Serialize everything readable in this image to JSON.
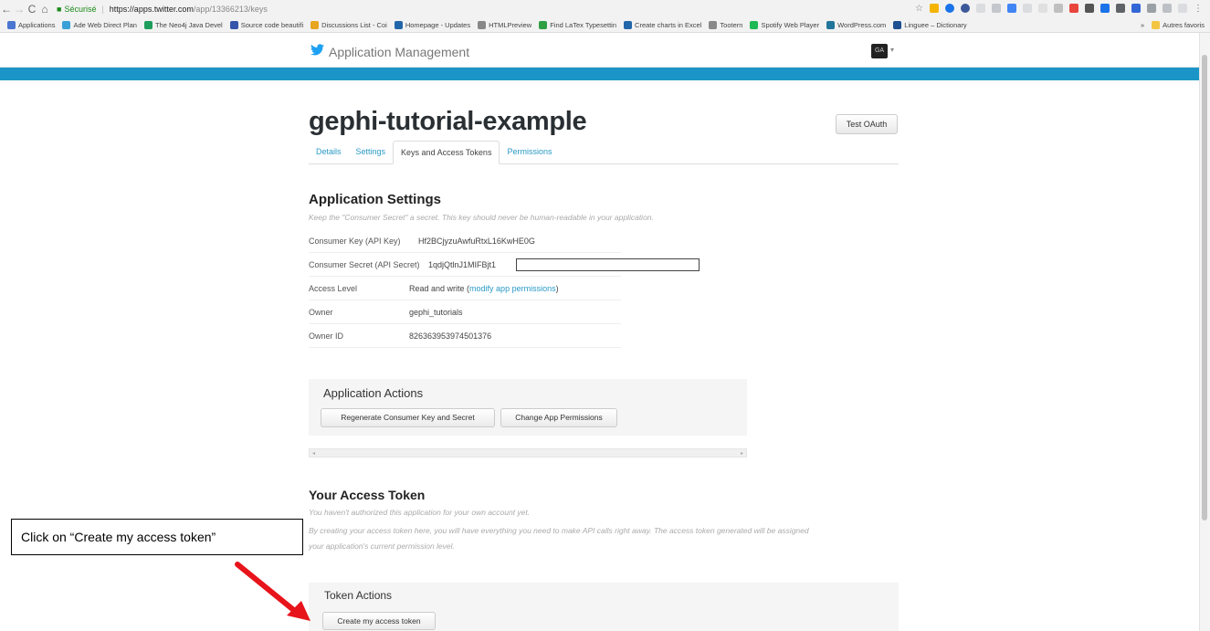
{
  "browser": {
    "secure_label": "Sécurisé",
    "url_host": "https://apps.twitter.com",
    "url_path": "/app/13366213/keys",
    "bookmarks": [
      {
        "label": "Applications",
        "color": "#4a76d1"
      },
      {
        "label": "Ade Web Direct Plan",
        "color": "#3aa0d8"
      },
      {
        "label": "The Neo4j Java Devel",
        "color": "#1e9e5a"
      },
      {
        "label": "Source code beautifi",
        "color": "#3355aa"
      },
      {
        "label": "Discussions List - Coi",
        "color": "#e8a520"
      },
      {
        "label": "Homepage - Updates",
        "color": "#2266aa"
      },
      {
        "label": "HTMLPreview",
        "color": "#888888"
      },
      {
        "label": "Find LaTex Typesettin",
        "color": "#2ea043"
      },
      {
        "label": "Create charts in Excel",
        "color": "#2266aa"
      },
      {
        "label": "Tootern",
        "color": "#888888"
      },
      {
        "label": "Spotify Web Player",
        "color": "#1db954"
      },
      {
        "label": "WordPress.com",
        "color": "#21759b"
      },
      {
        "label": "Linguee – Dictionary",
        "color": "#1d4f91"
      }
    ],
    "bookmarks_more": "»",
    "other_bookmarks": "Autres favoris"
  },
  "header": {
    "brand": "Application Management",
    "avatar_initials": "GA"
  },
  "app": {
    "title": "gephi-tutorial-example",
    "test_oauth": "Test OAuth",
    "tabs": [
      {
        "label": "Details"
      },
      {
        "label": "Settings"
      },
      {
        "label": "Keys and Access Tokens"
      },
      {
        "label": "Permissions"
      }
    ]
  },
  "settings": {
    "heading": "Application Settings",
    "note": "Keep the \"Consumer Secret\" a secret. This key should never be human-readable in your application.",
    "rows": [
      {
        "label": "Consumer Key (API Key)",
        "value": "Hf2BCjyzuAwfuRtxL16KwHE0G"
      },
      {
        "label": "Consumer Secret (API Secret)",
        "value": "1qdjQtlnJ1MIFBjt1"
      },
      {
        "label": "Access Level",
        "value": "Read and write (",
        "link": "modify app permissions",
        "after": ")"
      },
      {
        "label": "Owner",
        "value": "gephi_tutorials"
      },
      {
        "label": "Owner ID",
        "value": "826363953974501376"
      }
    ]
  },
  "app_actions": {
    "title": "Application Actions",
    "regenerate": "Regenerate Consumer Key and Secret",
    "change_permissions": "Change App Permissions",
    "scroll_left": "◂",
    "scroll_right": "▸"
  },
  "access_token": {
    "heading": "Your Access Token",
    "note1": "You haven't authorized this application for your own account yet.",
    "note2a": "By creating your access token here, you will have everything you need to make API calls right away. The access token generated will be assigned",
    "note2b": "your application's current permission level."
  },
  "token_actions": {
    "title": "Token Actions",
    "create": "Create my access token"
  },
  "callout": {
    "text": "Click on “Create my access token”",
    "arrow_color": "#e8141b"
  }
}
